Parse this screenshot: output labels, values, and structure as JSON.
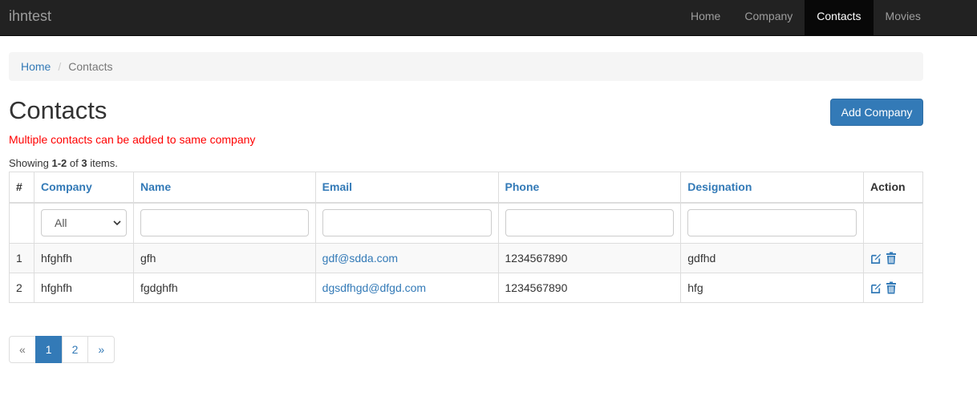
{
  "navbar": {
    "brand": "ihntest",
    "items": [
      {
        "label": "Home",
        "active": false
      },
      {
        "label": "Company",
        "active": false
      },
      {
        "label": "Contacts",
        "active": true
      },
      {
        "label": "Movies",
        "active": false
      }
    ]
  },
  "breadcrumb": {
    "home": "Home",
    "separator": "/",
    "current": "Contacts"
  },
  "page": {
    "title": "Contacts",
    "add_button": "Add Company",
    "notice": "Multiple contacts can be added to same company",
    "summary": {
      "prefix": "Showing ",
      "range": "1-2",
      "of": " of ",
      "total": "3",
      "suffix": " items."
    }
  },
  "table": {
    "headers": [
      "#",
      "Company",
      "Name",
      "Email",
      "Phone",
      "Designation",
      "Action"
    ],
    "company_filter": "All",
    "rows": [
      {
        "num": "1",
        "company": "hfghfh",
        "name": "gfh",
        "email": "gdf@sdda.com",
        "phone": "1234567890",
        "designation": "gdfhd"
      },
      {
        "num": "2",
        "company": "hfghfh",
        "name": "fgdghfh",
        "email": "dgsdfhgd@dfgd.com",
        "phone": "1234567890",
        "designation": "hfg"
      }
    ]
  },
  "pagination": {
    "prev": "«",
    "pages": [
      "1",
      "2"
    ],
    "next": "»",
    "active_page": "1"
  },
  "icons": {
    "edit": "edit-icon",
    "delete": "trash-icon",
    "dropdown": "chevron-down-icon"
  },
  "colors": {
    "navbar": "#222222",
    "accent": "#337ab7",
    "notice": "#ff0000"
  }
}
